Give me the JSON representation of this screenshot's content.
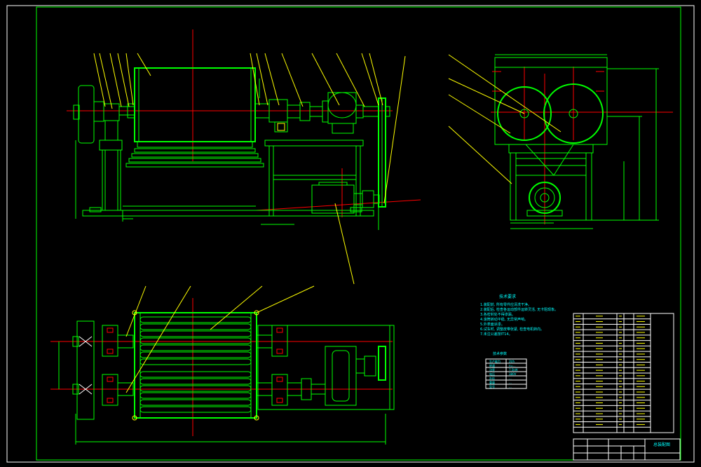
{
  "notes": {
    "title": "技术要求",
    "lines": [
      "1.装配前, 所有零件应清洗干净。",
      "2.装配后, 检查各运动部件运转灵活, 无卡阻现象。",
      "3.各密封处不得渗漏。",
      "4.滚筒转动平稳, 无异常声响。",
      "5.外表面涂漆。",
      "6.试车时, 调整皮带张紧, 检查电机转向。",
      "7.未注公差按IT14。"
    ]
  },
  "spec_table": {
    "title": "技术参数",
    "rows": [
      [
        "生产能力",
        "2t/h"
      ],
      [
        "转速",
        "n=..."
      ],
      [
        "功率",
        "7.5kW"
      ],
      [
        "电压",
        "380V"
      ],
      [
        "外形",
        "..."
      ],
      [
        "重量",
        "..."
      ],
      [
        "型号",
        "..."
      ]
    ]
  },
  "bom": {
    "rows": 22
  },
  "title_block": {
    "drawing_name": "总装配图"
  }
}
